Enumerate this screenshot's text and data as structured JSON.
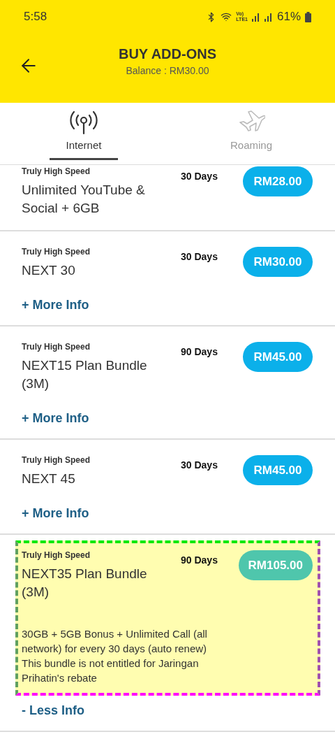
{
  "status_bar": {
    "time": "5:58",
    "network_top": "Vo)",
    "network_bottom": "LTE1",
    "battery": "61%"
  },
  "header": {
    "title": "BUY ADD-ONS",
    "balance": "Balance : RM30.00"
  },
  "tabs": [
    {
      "label": "Internet",
      "kind": "antenna",
      "selected": true
    },
    {
      "label": "Roaming",
      "kind": "plane",
      "selected": false
    }
  ],
  "plans": [
    {
      "category": "Truly High Speed",
      "name": "Unlimited YouTube & Social + 6GB",
      "duration": "30 Days",
      "price": "RM28.00",
      "highlighted": false
    },
    {
      "category": "Truly High Speed",
      "name": "NEXT 30",
      "duration": "30 Days",
      "price": "RM30.00",
      "info_link": "+ More Info",
      "highlighted": false
    },
    {
      "category": "Truly High Speed",
      "name": "NEXT15 Plan Bundle (3M)",
      "duration": "90 Days",
      "price": "RM45.00",
      "info_link": "+ More Info",
      "highlighted": false
    },
    {
      "category": "Truly High Speed",
      "name": "NEXT 45",
      "duration": "30 Days",
      "price": "RM45.00",
      "info_link": "+ More Info",
      "highlighted": false
    },
    {
      "category": "Truly High Speed",
      "name": "NEXT35 Plan Bundle (3M)",
      "duration": "90 Days",
      "price": "RM105.00",
      "details": [
        "30GB + 5GB Bonus + Unlimited Call (all network) for every 30 days (auto renew)",
        "This bundle is not entitled for Jaringan Prihatin's rebate"
      ],
      "info_link": "- Less Info",
      "highlighted": true
    }
  ]
}
